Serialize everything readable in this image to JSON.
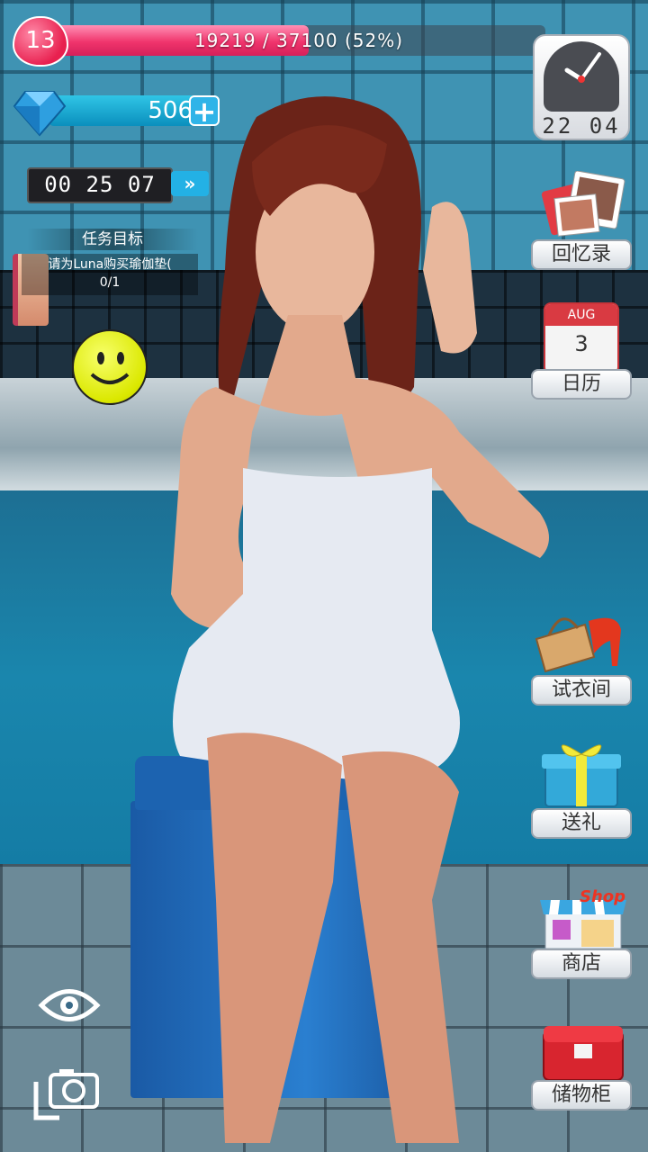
{
  "hud": {
    "level": "13",
    "xp_text": "19219 / 37100 (52%)",
    "xp_fraction": 0.52,
    "gems": "506",
    "timer": "00 25 07",
    "quest_title": "任务目标",
    "quest_text": "请为Luna购买瑜伽垫(",
    "quest_progress": "0/1",
    "clock_time": "22 04"
  },
  "icons": {
    "level": "heart-icon",
    "gems": "diamond-icon",
    "add_gems": "plus-icon",
    "fast_forward": "fast-forward-icon",
    "mood": "smiley-icon",
    "clock": "clock-icon",
    "view": "eye-icon",
    "camera": "camera-icon"
  },
  "menu": {
    "memories": "回忆录",
    "calendar_month": "AUG",
    "calendar_day": "3",
    "calendar": "日历",
    "wardrobe": "试衣间",
    "gift": "送礼",
    "shop_sign": "Shop",
    "shop": "商店",
    "storage": "储物柜"
  },
  "colors": {
    "xp_fill": "#f0346c",
    "gem_bar": "#0a8fbd",
    "calendar_red": "#d93a42"
  }
}
